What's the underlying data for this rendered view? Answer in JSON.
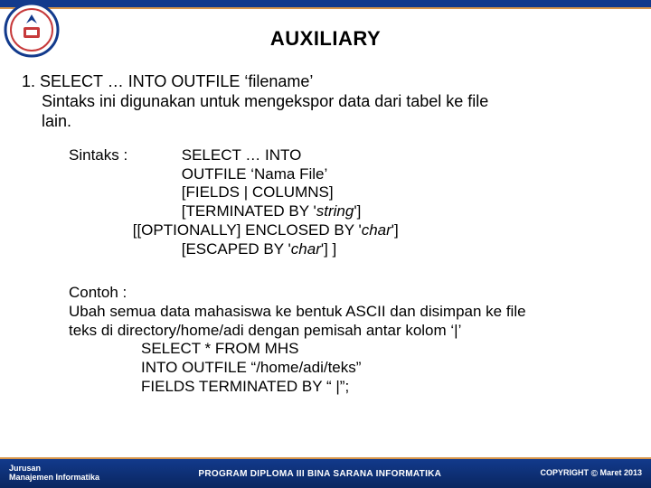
{
  "title": "AUXILIARY",
  "para1": {
    "line1": "1. SELECT … INTO OUTFILE ‘filename’",
    "line2": "Sintaks ini digunakan untuk mengekspor data dari tabel ke file",
    "line3": "lain."
  },
  "syntax": {
    "label": "Sintaks  :",
    "l1": "SELECT … INTO",
    "l2": "OUTFILE ‘Nama File’",
    "l3": "[FIELDS | COLUMNS]",
    "l4_a": "[TERMINATED BY '",
    "l4_b": "string",
    "l4_c": "']",
    "l5_a": "[[OPTIONALLY] ENCLOSED BY '",
    "l5_b": "char",
    "l5_c": "']",
    "l6_a": "[ESCAPED BY '",
    "l6_b": "char",
    "l6_c": "'] ]"
  },
  "example": {
    "l1": "Contoh :",
    "l2": "Ubah semua data mahasiswa ke bentuk ASCII dan disimpan ke file",
    "l3": "teks di directory/home/adi dengan pemisah antar kolom ‘|’",
    "s1": "SELECT * FROM MHS",
    "s2": "INTO OUTFILE “/home/adi/teks”",
    "s3": "FIELDS TERMINATED BY “ |”;"
  },
  "footer": {
    "left1": "Jurusan",
    "left2": "Manajemen Informatika",
    "center": "PROGRAM DIPLOMA III BINA SARANA INFORMATIKA",
    "right_prefix": "COPYRIGHT",
    "right_suffix": "Maret 2013"
  },
  "icons": {
    "copyright": "©"
  },
  "colors": {
    "brand_blue": "#123a8c",
    "accent_gold": "#d7954a",
    "logo_red": "#c73a3b"
  }
}
